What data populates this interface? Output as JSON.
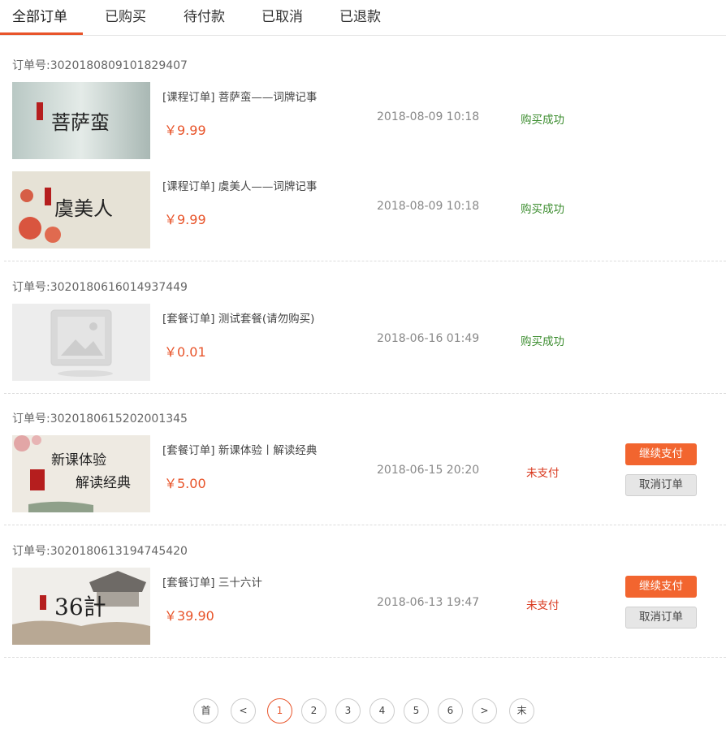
{
  "tabs": [
    {
      "label": "全部订单",
      "active": true
    },
    {
      "label": "已购买"
    },
    {
      "label": "待付款"
    },
    {
      "label": "已取消"
    },
    {
      "label": "已退款"
    }
  ],
  "order_prefix": "订单号:",
  "orders": [
    {
      "order_no": "3020180809101829407",
      "items": [
        {
          "title": "[课程订单] 菩萨蛮——词牌记事",
          "price": "￥9.99",
          "time": "2018-08-09 10:18",
          "status": "购买成功",
          "thumb_text": "菩萨蛮"
        },
        {
          "title": "[课程订单] 虞美人——词牌记事",
          "price": "￥9.99",
          "time": "2018-08-09 10:18",
          "status": "购买成功",
          "thumb_text": "虞美人"
        }
      ]
    },
    {
      "order_no": "3020180616014937449",
      "items": [
        {
          "title": "[套餐订单] 测试套餐(请勿购买)",
          "price": "￥0.01",
          "time": "2018-06-16 01:49",
          "status": "购买成功"
        }
      ]
    },
    {
      "order_no": "3020180615202001345",
      "items": [
        {
          "title": "[套餐订单] 新课体验丨解读经典",
          "price": "￥5.00",
          "time": "2018-06-15 20:20",
          "status": "未支付",
          "pay_label": "继续支付",
          "cancel_label": "取消订单",
          "thumb_text_1": "新课体验",
          "thumb_text_2": "解读经典"
        }
      ]
    },
    {
      "order_no": "3020180613194745420",
      "items": [
        {
          "title": "[套餐订单] 三十六计",
          "price": "￥39.90",
          "time": "2018-06-13 19:47",
          "status": "未支付",
          "pay_label": "继续支付",
          "cancel_label": "取消订单",
          "thumb_text": "36計"
        }
      ]
    }
  ],
  "pagination": {
    "first": "首",
    "prev": "<",
    "pages": [
      "1",
      "2",
      "3",
      "4",
      "5",
      "6"
    ],
    "current": "1",
    "next": ">",
    "last": "末"
  },
  "colors": {
    "accent": "#e8542a",
    "success": "#3c8d2f",
    "unpaid": "#d9381e",
    "pay_button": "#f2652f"
  }
}
